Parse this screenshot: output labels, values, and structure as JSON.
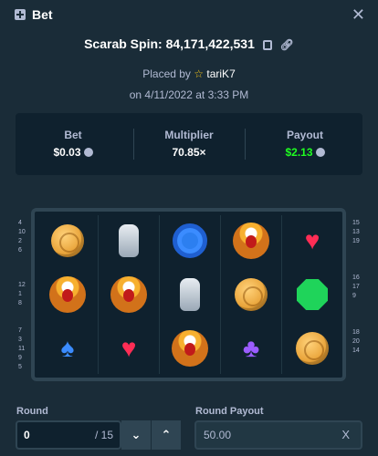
{
  "header": {
    "title": "Bet",
    "close": "✕"
  },
  "spin": {
    "label": "Scarab Spin: 84,171,422,531"
  },
  "placed": {
    "prefix": "Placed by",
    "user": "tariK7",
    "date": "on 4/11/2022 at 3:33 PM"
  },
  "stats": {
    "bet_label": "Bet",
    "bet_value": "$0.03",
    "multiplier_label": "Multiplier",
    "multiplier_value": "70.85×",
    "payout_label": "Payout",
    "payout_value": "$2.13"
  },
  "paylines": {
    "left_top": [
      "4",
      "10",
      "2",
      "6"
    ],
    "left_mid": [
      "12",
      "1",
      "8"
    ],
    "left_bot": [
      "7",
      "3",
      "11",
      "9",
      "5"
    ],
    "right_top": [
      "15",
      "13",
      "19"
    ],
    "right_mid": [
      "16",
      "17",
      "9"
    ],
    "right_bot": [
      "18",
      "20",
      "14"
    ]
  },
  "grid": {
    "rows": [
      [
        "coin",
        "statue",
        "ring",
        "scarab",
        "heart"
      ],
      [
        "scarab",
        "scarab",
        "statue",
        "coin",
        "emerald"
      ],
      [
        "spade",
        "heart",
        "scarab",
        "club",
        "coin"
      ]
    ]
  },
  "round": {
    "label": "Round",
    "value": "0",
    "total": "/ 15"
  },
  "round_payout": {
    "label": "Round Payout",
    "value": "50.00",
    "clear": "X"
  },
  "colors": {
    "bg": "#1a2c38",
    "panel": "#0f212e",
    "accent_green": "#1fff20"
  }
}
